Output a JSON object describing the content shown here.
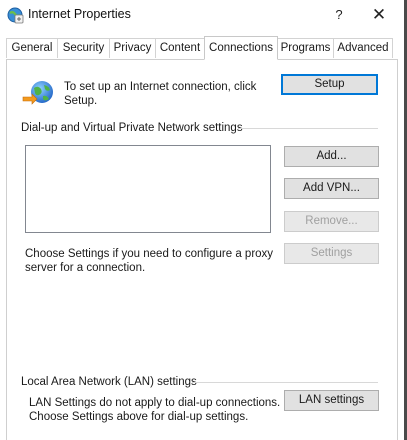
{
  "window": {
    "title": "Internet Properties",
    "help_label": "?",
    "close_label": "✕"
  },
  "tabs": [
    {
      "label": "General",
      "active": false
    },
    {
      "label": "Security",
      "active": false
    },
    {
      "label": "Privacy",
      "active": false
    },
    {
      "label": "Content",
      "active": false
    },
    {
      "label": "Connections",
      "active": true
    },
    {
      "label": "Programs",
      "active": false
    },
    {
      "label": "Advanced",
      "active": false
    }
  ],
  "setup": {
    "text": "To set up an Internet connection, click Setup.",
    "button_label": "Setup"
  },
  "dialup": {
    "group_label": "Dial-up and Virtual Private Network settings",
    "list_items": [],
    "add_label": "Add...",
    "add_vpn_label": "Add VPN...",
    "remove_label": "Remove...",
    "remove_enabled": false,
    "proxy_text": "Choose Settings if you need to configure a proxy server for a connection.",
    "settings_label": "Settings",
    "settings_enabled": false
  },
  "lan": {
    "group_label": "Local Area Network (LAN) settings",
    "text": "LAN Settings do not apply to dial-up connections. Choose Settings above for dial-up settings.",
    "button_label": "LAN settings"
  },
  "colors": {
    "accent_border": "#0078d7",
    "button_face": "#e1e1e1",
    "disabled_text": "#a0a0a0"
  }
}
